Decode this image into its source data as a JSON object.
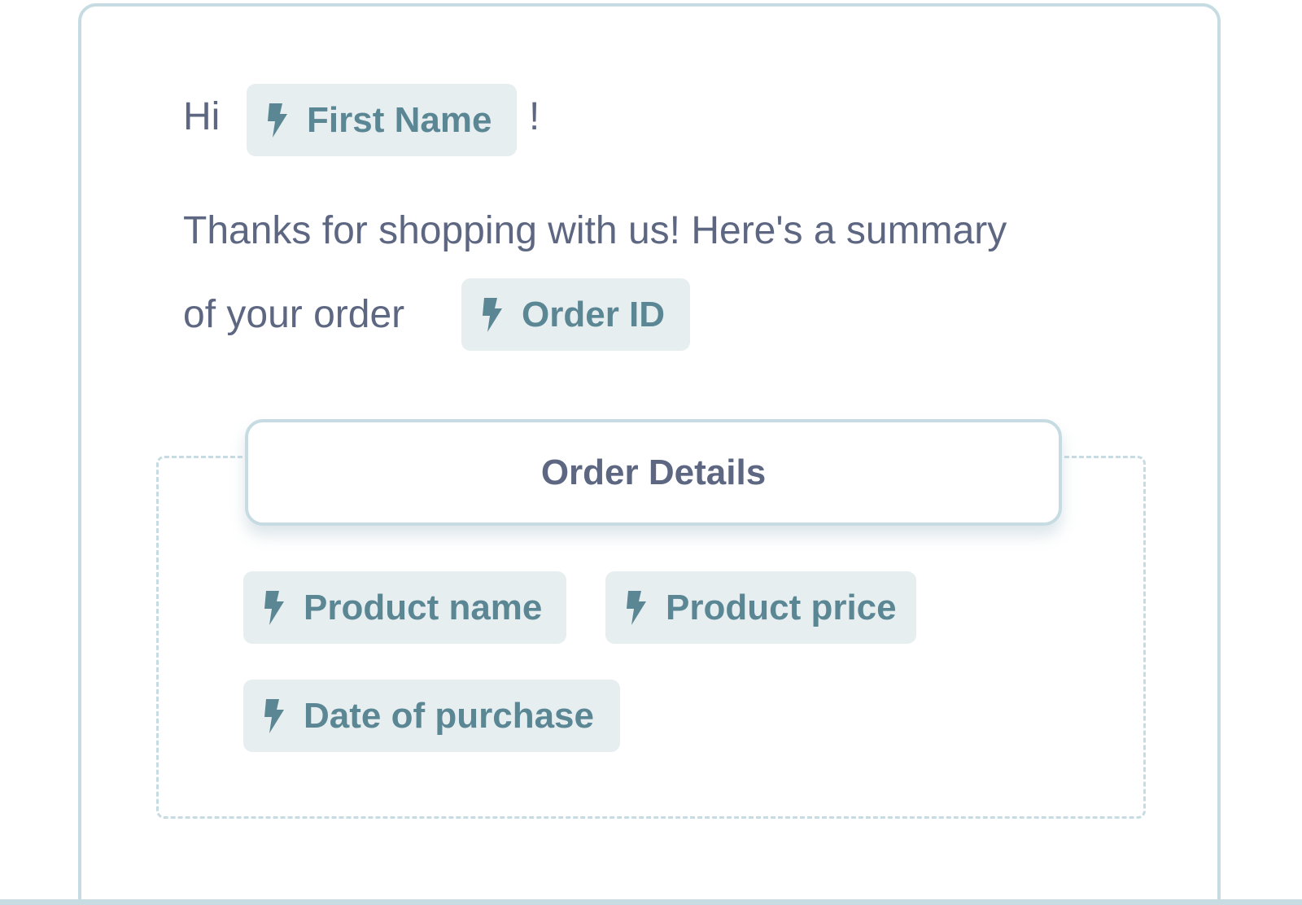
{
  "message": {
    "greeting": "Hi",
    "first_name_token": "First Name",
    "exclamation": "!",
    "line1": "Thanks for shopping with us! Here's a summary",
    "line2": "of your order",
    "order_id_token": "Order ID"
  },
  "order_section": {
    "title": "Order Details",
    "tokens": [
      "Product name",
      "Product price",
      "Date of purchase"
    ]
  },
  "icons": {
    "token_icon": "lightning-bolt-icon"
  },
  "colors": {
    "border": "#c7dbe2",
    "token_background": "#e7eef0",
    "token_text": "#5b8794",
    "body_text": "#5d6782"
  }
}
